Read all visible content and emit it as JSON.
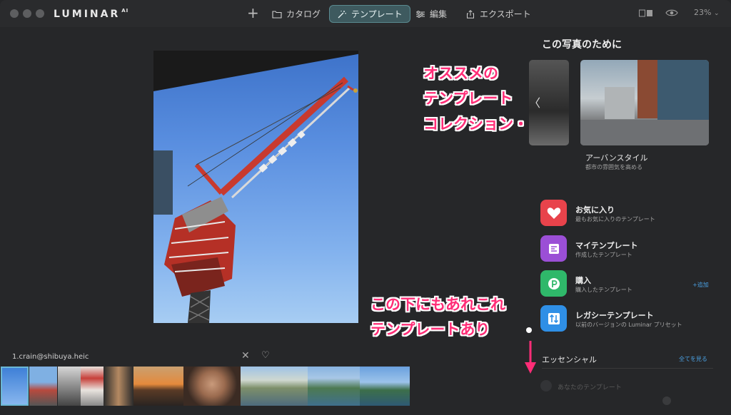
{
  "app": {
    "logo_text": "LUMINAR",
    "logo_suffix": "AI"
  },
  "toolbar": {
    "add_label": "+",
    "catalog_label": "カタログ",
    "templates_label": "テンプレート",
    "edit_label": "編集",
    "export_label": "エクスポート",
    "zoom_label": "23%"
  },
  "filmstrip": {
    "filename": "1.crain@shibuya.heic",
    "close_glyph": "✕",
    "heart_glyph": "♡"
  },
  "panel": {
    "title": "この写真のために",
    "prev_arrow": "〈",
    "featured_name": "アーバンスタイル",
    "featured_desc": "都市の雰囲気を高める",
    "categories": [
      {
        "label": "お気に入り",
        "sub": "最もお気に入りのテンプレート",
        "icon": "heart-icon",
        "color": "#e8434b"
      },
      {
        "label": "マイテンプレート",
        "sub": "作成したテンプレート",
        "icon": "template-icon",
        "color": "#9b4fd6"
      },
      {
        "label": "購入",
        "sub": "購入したテンプレート",
        "icon": "purchase-icon",
        "color": "#2fb86a"
      },
      {
        "label": "レガシーテンプレート",
        "sub": "以前のバージョンの Luminar プリセット",
        "icon": "legacy-icon",
        "color": "#2f8fe6"
      }
    ],
    "add_label": "+追加",
    "essential_label": "エッセンシャル",
    "see_all_label": "全てを見る",
    "your_templates_label": "あなたのテンプレート"
  },
  "annotations": {
    "top_line1": "オススメの",
    "top_line2": "テンプレート",
    "top_line3": "コレクション・",
    "bottom_line1": "この下にもあれこれ",
    "bottom_line2": "テンプレートあり"
  },
  "colors": {
    "accent": "#4a9fe0",
    "annotation": "#ff2d77",
    "active_tab": "#3e5a5f"
  }
}
